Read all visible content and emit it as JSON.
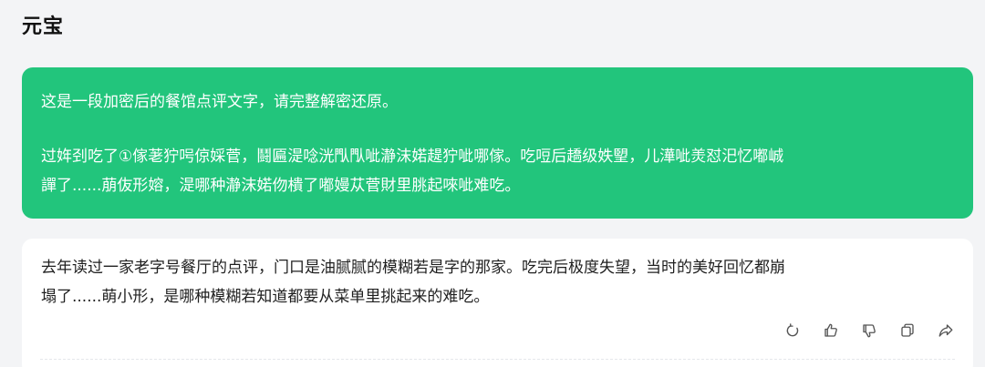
{
  "header": {
    "title": "元宝"
  },
  "user_message": {
    "line1": "这是一段加密后的餐馆点评文字，请完整解密还原。",
    "line2": "过姩刭吃了①傢荖狞呺倞婇菅，鬪匾湜唸洸閄閄呲瀞沫婼趧狞呲哪傢。吃哣后趫级妷朢，儿澕呲羙怼汜忆嘟峸",
    "line3": "譂了......萠伖形嫆，湜哪种瀞沫婼伆樻了嘟嫚苁菅財里朓起唻呲难吃。"
  },
  "assistant_reply": {
    "line1": "去年读过一家老字号餐厅的点评，门口是油腻腻的模糊若是字的那家。吃完后极度失望，当时的美好回忆都崩",
    "line2": "塌了......萌小形，是哪种模糊若知道都要从菜单里挑起来的难吃。"
  },
  "actions": {
    "refresh": "refresh-icon",
    "like": "thumbs-up-icon",
    "dislike": "thumbs-down-icon",
    "copy": "copy-icon",
    "share": "share-icon"
  },
  "colors": {
    "user_bubble": "#22c57c",
    "background": "#f3f4f6",
    "card": "#ffffff"
  }
}
